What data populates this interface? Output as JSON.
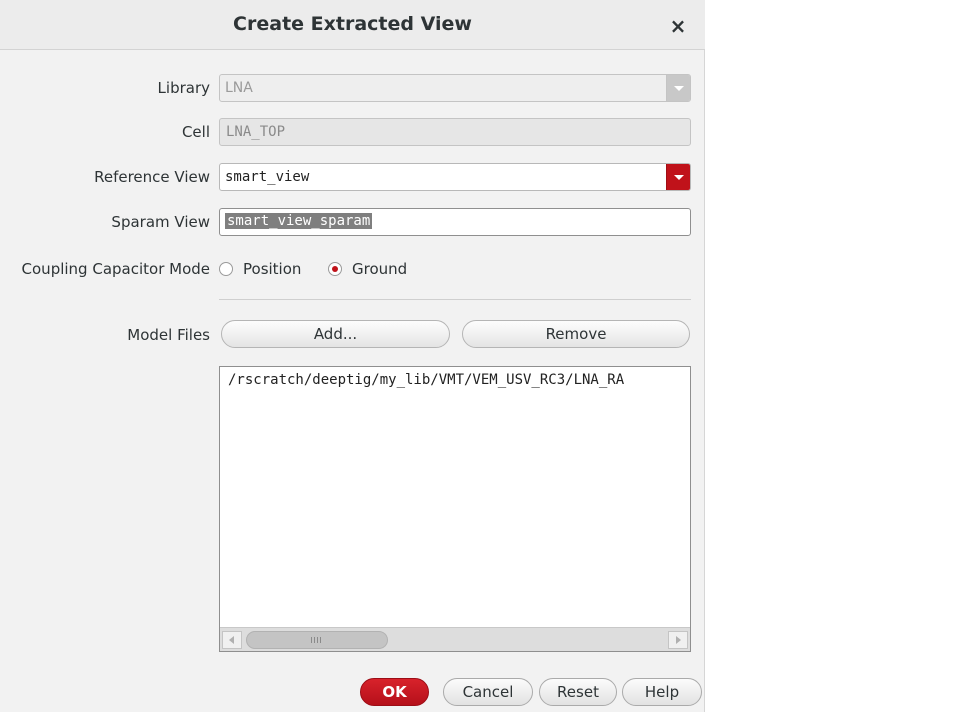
{
  "dialog": {
    "title": "Create Extracted View",
    "close_label": "×"
  },
  "form": {
    "library": {
      "label": "Library",
      "value": "LNA",
      "enabled": false
    },
    "cell": {
      "label": "Cell",
      "value": "LNA_TOP",
      "enabled": false
    },
    "reference_view": {
      "label": "Reference View",
      "value": "smart_view"
    },
    "sparam_view": {
      "label": "Sparam View",
      "value": "smart_view_sparam",
      "selected": true
    },
    "coupling_mode": {
      "label": "Coupling Capacitor Mode",
      "options": [
        {
          "label": "Position",
          "checked": false
        },
        {
          "label": "Ground",
          "checked": true
        }
      ]
    },
    "model_files": {
      "label": "Model Files",
      "add_label": "Add...",
      "remove_label": "Remove",
      "items": [
        "/rscratch/deeptig/my_lib/VMT/VEM_USV_RC3/LNA_RA"
      ]
    }
  },
  "footer": {
    "ok_label": "OK",
    "cancel_label": "Cancel",
    "reset_label": "Reset",
    "help_label": "Help"
  },
  "colors": {
    "accent": "#c0121a",
    "dialog_bg": "#f2f2f2"
  }
}
